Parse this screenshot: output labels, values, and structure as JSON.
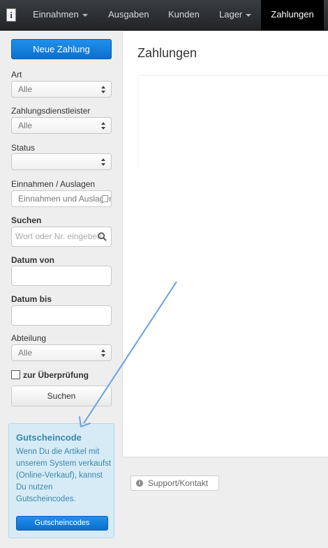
{
  "navbar": {
    "brand_glyph": "i",
    "items": [
      {
        "label": "Einnahmen",
        "has_caret": true
      },
      {
        "label": "Ausgaben",
        "has_caret": false
      },
      {
        "label": "Kunden",
        "has_caret": false
      },
      {
        "label": "Lager",
        "has_caret": true
      },
      {
        "label": "Zahlungen",
        "has_caret": false,
        "active": true
      }
    ]
  },
  "sidebar": {
    "new_payment_button": "Neue Zahlung",
    "filters": {
      "art": {
        "label": "Art",
        "value": "Alle"
      },
      "provider": {
        "label": "Zahlungsdienstleister",
        "value": "Alle"
      },
      "status": {
        "label": "Status",
        "value": ""
      },
      "income_expense": {
        "label": "Einnahmen / Auslagen",
        "value": "Einnahmen und Auslagen"
      },
      "search": {
        "label": "Suchen",
        "placeholder": "Wort oder Nr. eingeben"
      },
      "date_from": {
        "label": "Datum von",
        "value": ""
      },
      "date_to": {
        "label": "Datum bis",
        "value": ""
      },
      "department": {
        "label": "Abteilung",
        "value": "Alle"
      },
      "review": {
        "label": "zur Überprüfung",
        "checked": false
      }
    },
    "search_button": "Suchen",
    "promo": {
      "title": "Gutscheincode",
      "text": "Wenn Du die Artikel mit unserem System verkaufst (Online-Verkauf), kannst Du nutzen Gutscheincodes.",
      "button": "Gutscheincodes"
    }
  },
  "main": {
    "title": "Zahlungen"
  },
  "footer": {
    "support_label": "Support/Kontakt"
  },
  "colors": {
    "primary": "#1a85e4",
    "navbar": "#2b2d2f",
    "promo_bg": "#d7ebf6",
    "promo_text": "#3a87ad",
    "annotation_arrow": "#6a9ee6"
  },
  "icons": {
    "search": "search-icon",
    "info": "info-icon",
    "select_arrows": "select-arrows-icon"
  }
}
